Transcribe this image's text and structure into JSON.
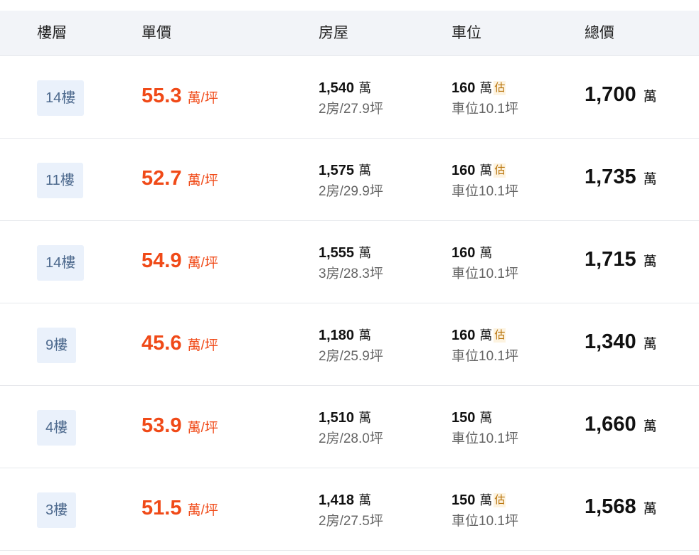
{
  "header": {
    "floor": "樓層",
    "unit_price": "單價",
    "house": "房屋",
    "parking": "車位",
    "total": "總價"
  },
  "rows": [
    {
      "floor": "14樓",
      "unit_price": "55.3",
      "unit_label": "萬/坪",
      "house_price": "1,540",
      "house_unit": "萬",
      "house_detail": "2房/27.9坪",
      "parking_price": "160",
      "parking_unit": "萬",
      "parking_est": "估",
      "parking_detail": "車位10.1坪",
      "total": "1,700",
      "total_unit": "萬"
    },
    {
      "floor": "11樓",
      "unit_price": "52.7",
      "unit_label": "萬/坪",
      "house_price": "1,575",
      "house_unit": "萬",
      "house_detail": "2房/29.9坪",
      "parking_price": "160",
      "parking_unit": "萬",
      "parking_est": "估",
      "parking_detail": "車位10.1坪",
      "total": "1,735",
      "total_unit": "萬"
    },
    {
      "floor": "14樓",
      "unit_price": "54.9",
      "unit_label": "萬/坪",
      "house_price": "1,555",
      "house_unit": "萬",
      "house_detail": "3房/28.3坪",
      "parking_price": "160",
      "parking_unit": "萬",
      "parking_est": "",
      "parking_detail": "車位10.1坪",
      "total": "1,715",
      "total_unit": "萬"
    },
    {
      "floor": "9樓",
      "unit_price": "45.6",
      "unit_label": "萬/坪",
      "house_price": "1,180",
      "house_unit": "萬",
      "house_detail": "2房/25.9坪",
      "parking_price": "160",
      "parking_unit": "萬",
      "parking_est": "估",
      "parking_detail": "車位10.1坪",
      "total": "1,340",
      "total_unit": "萬"
    },
    {
      "floor": "4樓",
      "unit_price": "53.9",
      "unit_label": "萬/坪",
      "house_price": "1,510",
      "house_unit": "萬",
      "house_detail": "2房/28.0坪",
      "parking_price": "150",
      "parking_unit": "萬",
      "parking_est": "",
      "parking_detail": "車位10.1坪",
      "total": "1,660",
      "total_unit": "萬"
    },
    {
      "floor": "3樓",
      "unit_price": "51.5",
      "unit_label": "萬/坪",
      "house_price": "1,418",
      "house_unit": "萬",
      "house_detail": "2房/27.5坪",
      "parking_price": "150",
      "parking_unit": "萬",
      "parking_est": "估",
      "parking_detail": "車位10.1坪",
      "total": "1,568",
      "total_unit": "萬"
    }
  ],
  "colors": {
    "accent": "#f04a18",
    "header_bg": "#f2f4f8",
    "badge_bg": "#eaf1fb",
    "badge_text": "#4e6a8e",
    "estimate": "#b8730a"
  }
}
